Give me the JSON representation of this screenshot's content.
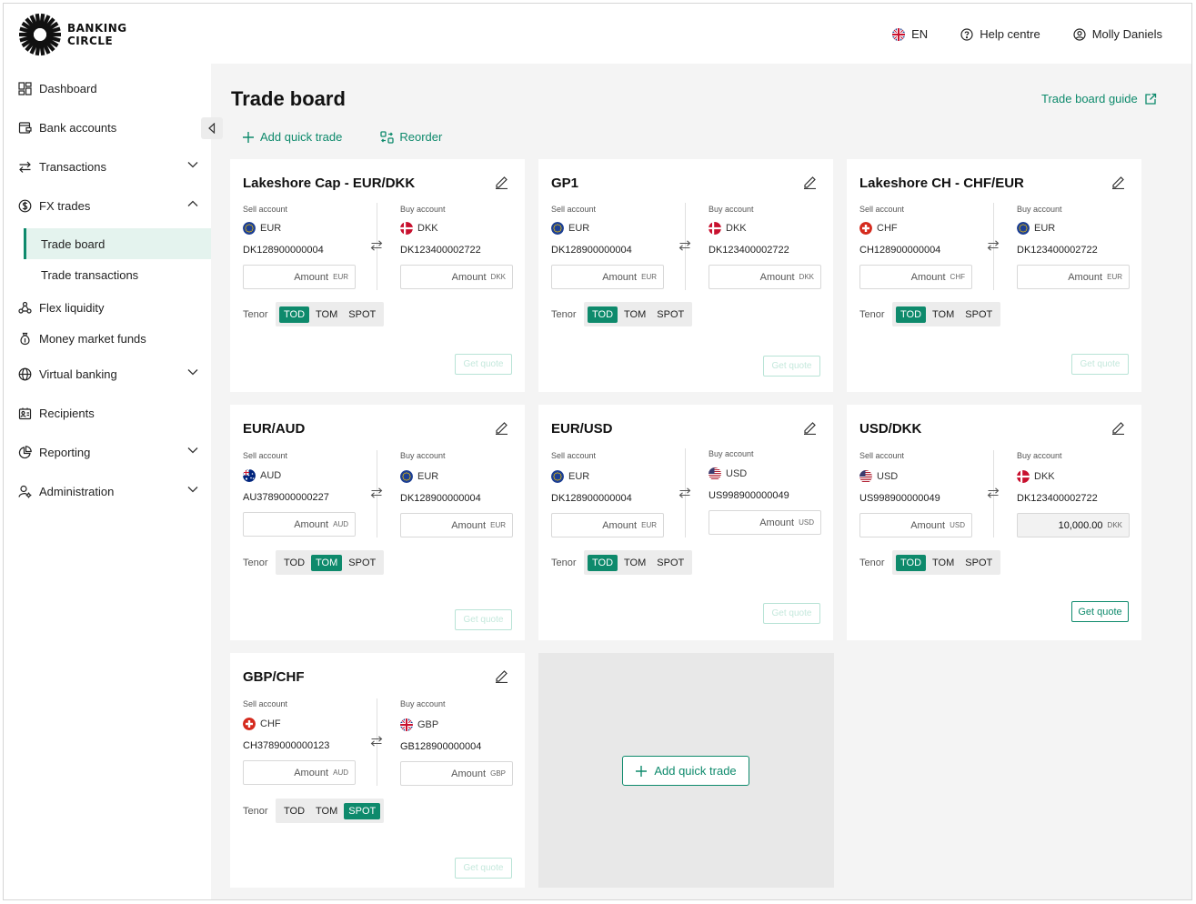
{
  "brand": {
    "line1": "BANKING",
    "line2": "CIRCLE"
  },
  "topnav": {
    "language": "EN",
    "help": "Help centre",
    "user": "Molly Daniels"
  },
  "sidebar": {
    "items": [
      {
        "label": "Dashboard",
        "icon": "dashboard-icon"
      },
      {
        "label": "Bank accounts",
        "icon": "bank-accounts-icon"
      },
      {
        "label": "Transactions",
        "icon": "transactions-icon",
        "expandable": true
      },
      {
        "label": "FX trades",
        "icon": "fx-trades-icon",
        "expanded": true,
        "children": [
          {
            "label": "Trade board",
            "active": true
          },
          {
            "label": "Trade transactions"
          }
        ]
      },
      {
        "label": "Flex liquidity",
        "icon": "flex-liquidity-icon"
      },
      {
        "label": "Money market funds",
        "icon": "money-market-icon"
      },
      {
        "label": "Virtual banking",
        "icon": "globe-icon",
        "expandable": true
      },
      {
        "label": "Recipients",
        "icon": "recipients-icon"
      },
      {
        "label": "Reporting",
        "icon": "reporting-icon",
        "expandable": true
      },
      {
        "label": "Administration",
        "icon": "administration-icon",
        "expandable": true
      }
    ]
  },
  "page": {
    "title": "Trade board",
    "guide_link": "Trade board guide",
    "add_quick_trade": "Add quick trade",
    "reorder": "Reorder"
  },
  "labels": {
    "sell_account": "Sell account",
    "buy_account": "Buy account",
    "amount": "Amount",
    "tenor": "Tenor",
    "get_quote": "Get quote",
    "tenor_options": [
      "TOD",
      "TOM",
      "SPOT"
    ]
  },
  "cards": [
    {
      "title": "Lakeshore Cap - EUR/DKK",
      "sell": {
        "currency": "EUR",
        "account": "DK128900000004",
        "amount_ccy": "EUR"
      },
      "buy": {
        "currency": "DKK",
        "account": "DK123400002722",
        "amount_ccy": "DKK"
      },
      "tenor_selected": "TOD",
      "quote_enabled": false
    },
    {
      "title": "GP1",
      "sell": {
        "currency": "EUR",
        "account": "DK128900000004",
        "amount_ccy": "EUR"
      },
      "buy": {
        "currency": "DKK",
        "account": "DK123400002722",
        "amount_ccy": "DKK"
      },
      "tenor_selected": "TOD",
      "quote_enabled": false
    },
    {
      "title": "Lakeshore CH - CHF/EUR",
      "sell": {
        "currency": "CHF",
        "account": "CH128900000004",
        "amount_ccy": "CHF"
      },
      "buy": {
        "currency": "EUR",
        "account": "DK123400002722",
        "amount_ccy": "EUR"
      },
      "tenor_selected": "TOD",
      "quote_enabled": false
    },
    {
      "title": "EUR/AUD",
      "sell": {
        "currency": "AUD",
        "account": "AU3789000000227",
        "amount_ccy": "AUD"
      },
      "buy": {
        "currency": "EUR",
        "account": "DK128900000004",
        "amount_ccy": "EUR"
      },
      "tenor_selected": "TOM",
      "quote_enabled": false
    },
    {
      "title": "EUR/USD",
      "sell": {
        "currency": "EUR",
        "account": "DK128900000004",
        "amount_ccy": "EUR"
      },
      "buy": {
        "currency": "USD",
        "account": "US998900000049",
        "amount_ccy": "USD"
      },
      "tenor_selected": "TOD",
      "quote_enabled": false
    },
    {
      "title": "USD/DKK",
      "sell": {
        "currency": "USD",
        "account": "US998900000049",
        "amount_ccy": "USD"
      },
      "buy": {
        "currency": "DKK",
        "account": "DK123400002722",
        "amount_ccy": "DKK",
        "amount_value": "10,000.00"
      },
      "tenor_selected": "TOD",
      "quote_enabled": true
    },
    {
      "title": "GBP/CHF",
      "sell": {
        "currency": "CHF",
        "account": "CH3789000000123",
        "amount_ccy": "AUD"
      },
      "buy": {
        "currency": "GBP",
        "account": "GB128900000004",
        "amount_ccy": "GBP"
      },
      "tenor_selected": "SPOT",
      "quote_enabled": false
    }
  ],
  "add_card": {
    "label": "Add quick trade"
  },
  "colors": {
    "brand_green": "#0e8a6c",
    "active_nav_bg": "#e4f3ee",
    "page_bg": "#f4f4f4"
  }
}
